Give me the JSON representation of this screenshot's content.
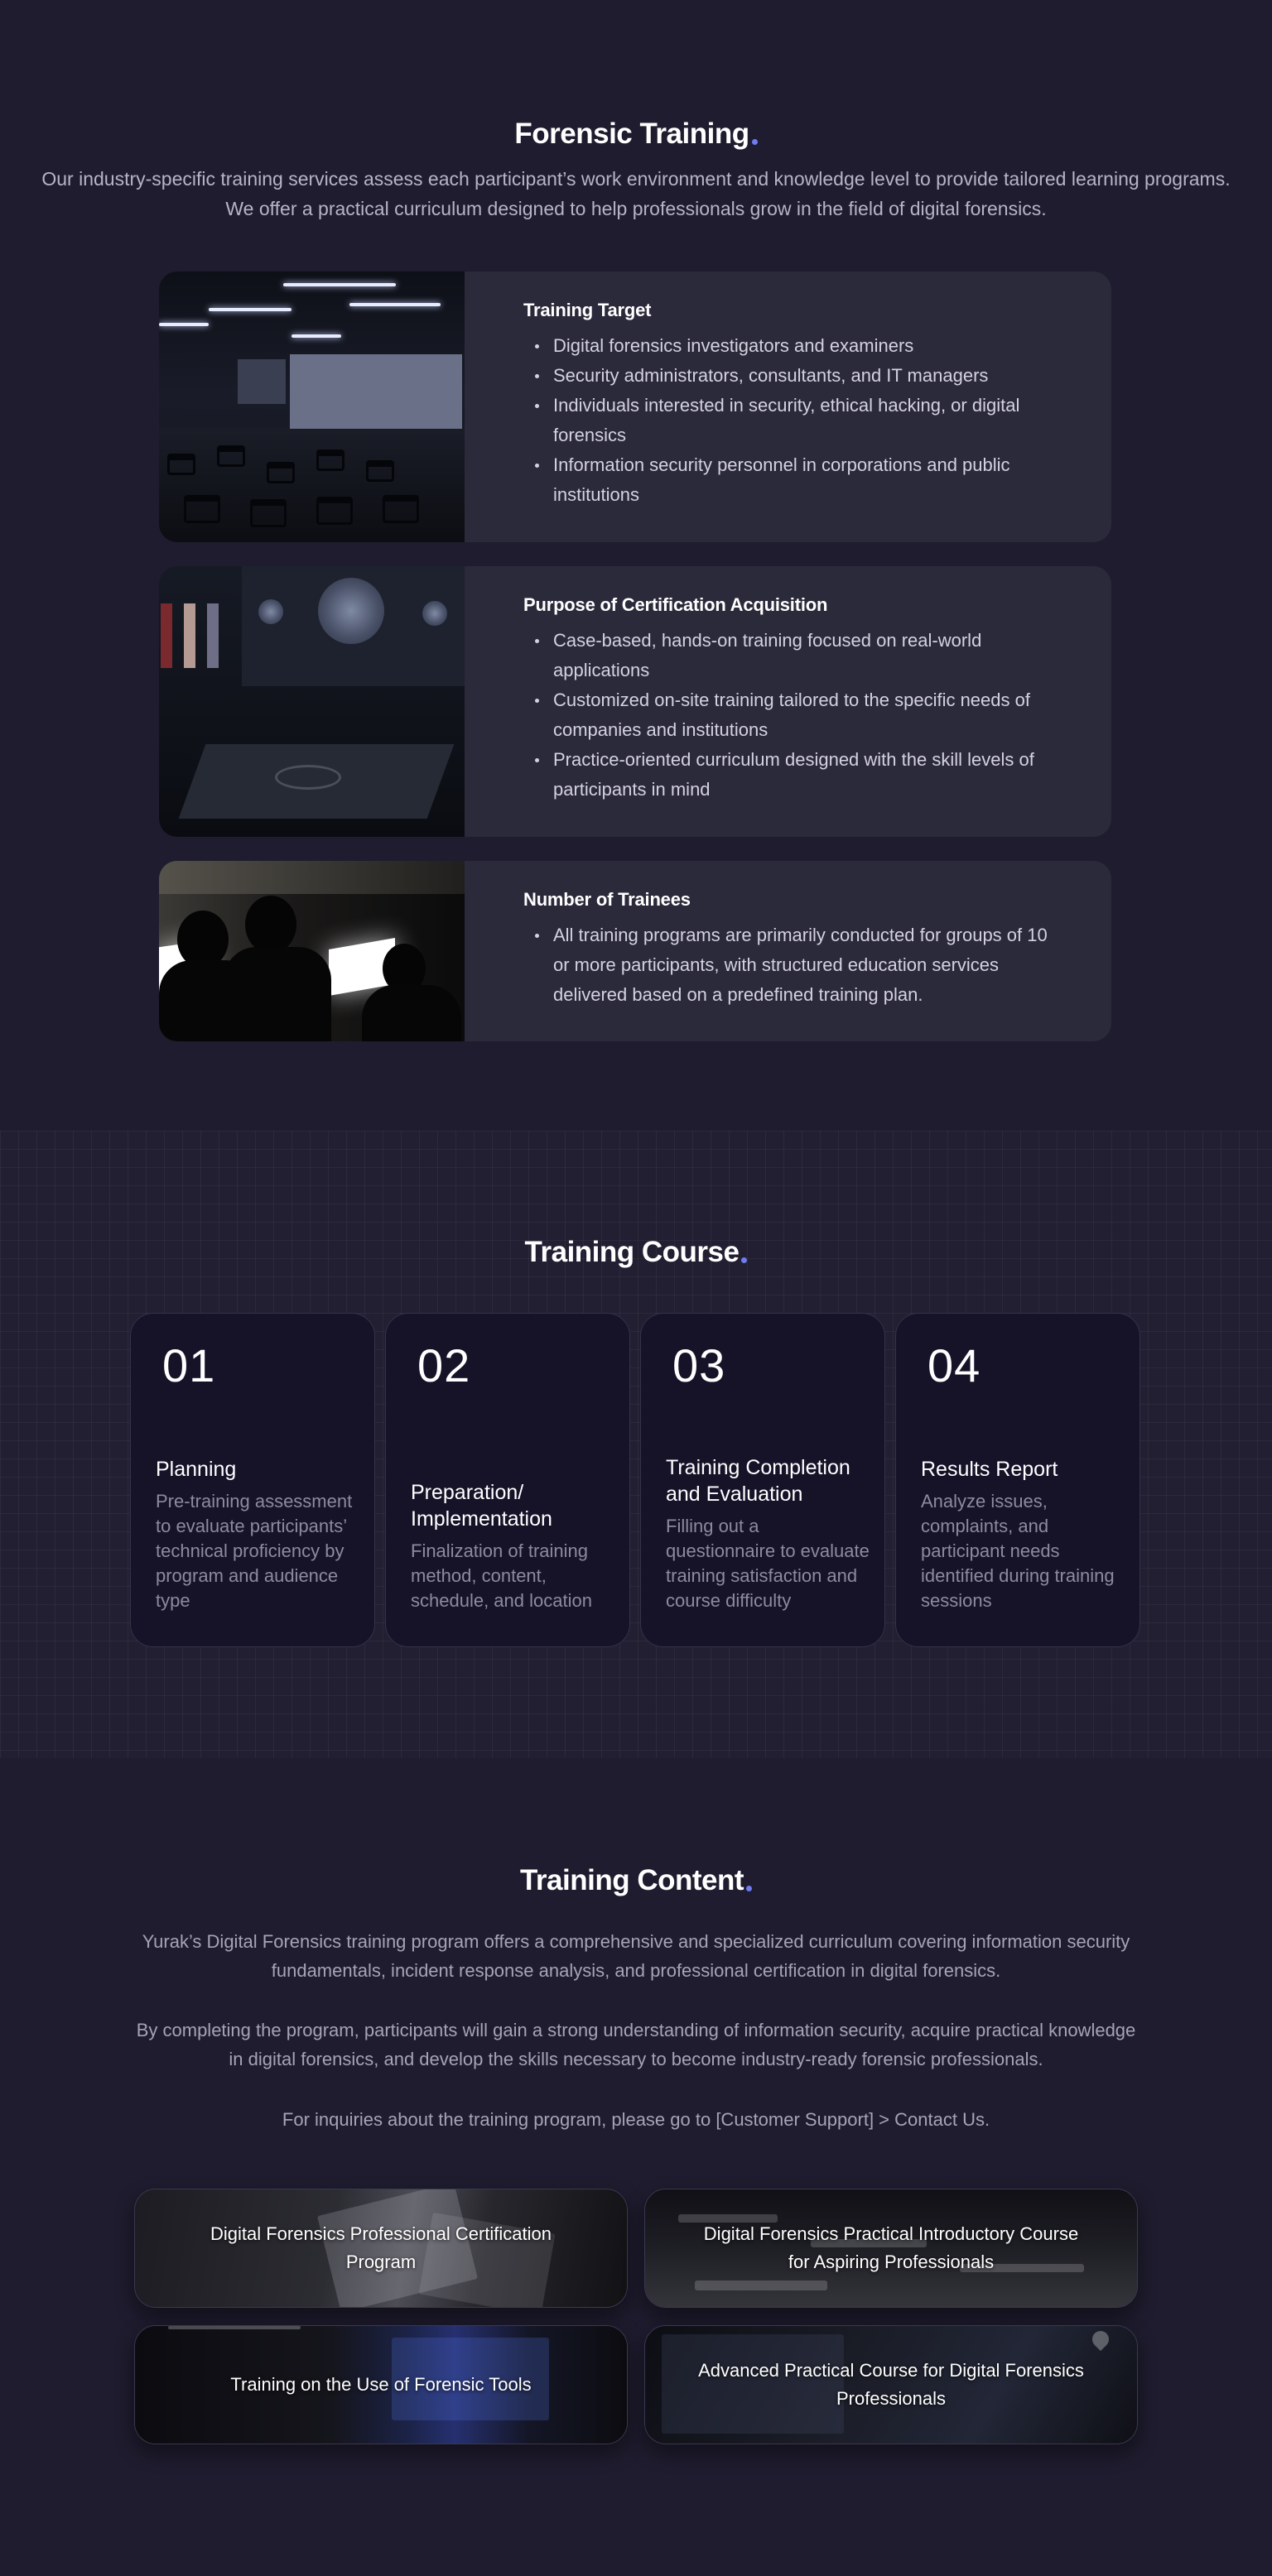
{
  "forensic_training": {
    "title": "Forensic Training",
    "intro_line1": "Our industry-specific training services assess each participant’s work environment and knowledge level to provide tailored learning programs.",
    "intro_line2": "We offer a practical curriculum designed to help professionals grow in the field of digital forensics.",
    "cards": [
      {
        "heading": "Training Target",
        "items": [
          "Digital forensics investigators and examiners",
          "Security administrators, consultants, and IT managers",
          "Individuals interested in security, ethical hacking, or digital forensics",
          "Information security personnel in corporations and public institutions"
        ]
      },
      {
        "heading": "Purpose of Certification Acquisition",
        "items": [
          "Case-based, hands-on training focused on real-world applications",
          "Customized on-site training tailored to the specific needs of companies and institutions",
          "Practice-oriented curriculum designed with the skill levels of participants in mind"
        ]
      },
      {
        "heading": "Number of Trainees",
        "items": [
          "All training programs are primarily conducted for groups of 10 or more participants, with structured education services delivered based on a predefined training plan."
        ]
      }
    ]
  },
  "training_course": {
    "title": "Training Course",
    "steps": [
      {
        "number": "01",
        "title": "Planning",
        "desc": "Pre-training assessment to evaluate participants’ technical proficiency by program and audience type"
      },
      {
        "number": "02",
        "title": "Preparation/ Implementation",
        "desc": "Finalization of training method, content, schedule, and location"
      },
      {
        "number": "03",
        "title": "Training Completion and Evaluation",
        "desc": "Filling out a questionnaire to evaluate training satisfaction and course difficulty"
      },
      {
        "number": "04",
        "title": "Results Report",
        "desc": "Analyze issues, complaints, and participant needs identified during training sessions"
      }
    ]
  },
  "training_content": {
    "title": "Training Content",
    "para1_line1": "Yurak’s Digital Forensics training program offers a comprehensive and specialized curriculum covering information security",
    "para1_line2": "fundamentals, incident response analysis, and professional certification in digital forensics.",
    "para2_line1": "By completing the program, participants will gain a strong understanding of information security, acquire practical knowledge",
    "para2_line2": "in digital forensics, and develop the skills necessary to become industry-ready forensic professionals.",
    "para3": "For inquiries about the training program, please go to [Customer Support] > Contact Us.",
    "programs": [
      {
        "label": "Digital Forensics Professional Certification Program"
      },
      {
        "label": "Digital Forensics Practical Introductory Course for Aspiring Professionals"
      },
      {
        "label": "Training on the Use of Forensic Tools"
      },
      {
        "label": "Advanced Practical Course for Digital Forensics Professionals"
      }
    ]
  },
  "colors": {
    "page_bg": "#1e1c2e",
    "card_bg": "#2b2a3b",
    "step_bg": "#161329",
    "accent_dot": "#6f7cf0"
  }
}
